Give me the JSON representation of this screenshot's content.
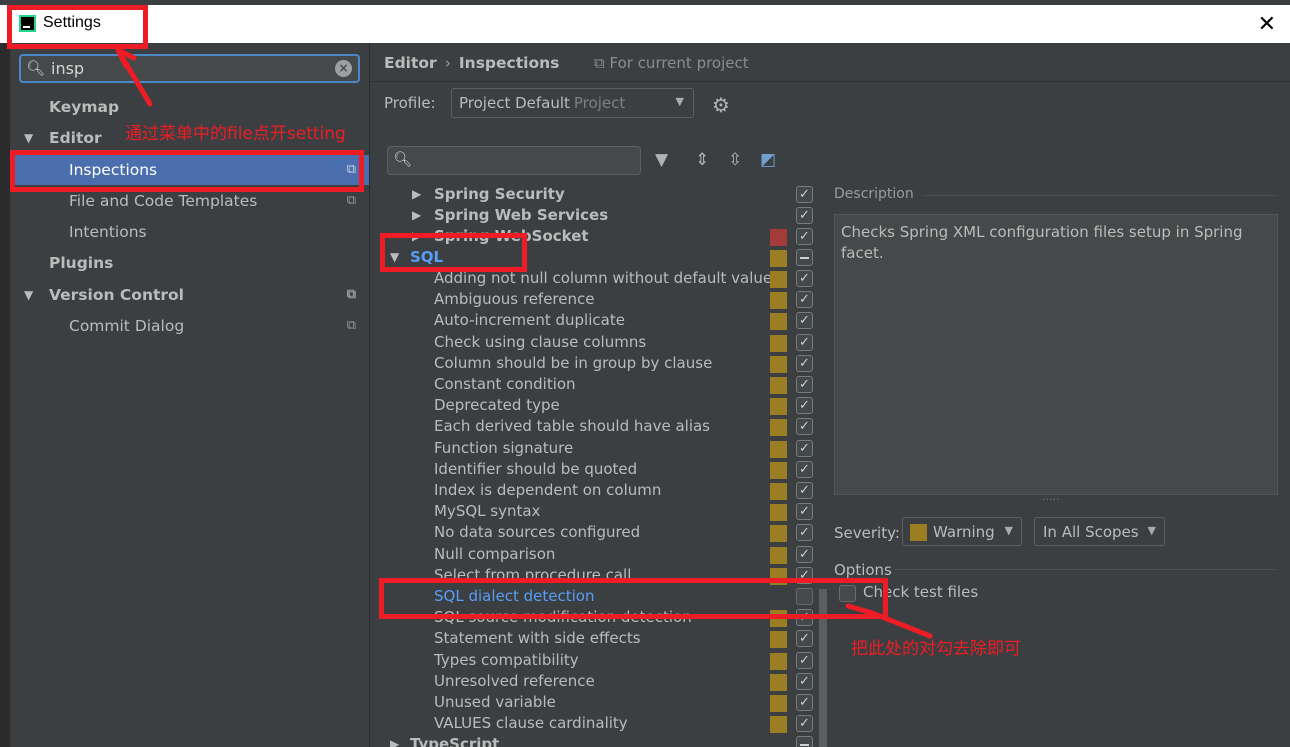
{
  "window": {
    "title": "Settings"
  },
  "sidebar": {
    "search_value": "insp",
    "items": [
      {
        "label": "Keymap"
      },
      {
        "label": "Editor"
      },
      {
        "label": "Inspections"
      },
      {
        "label": "File and Code Templates"
      },
      {
        "label": "Intentions"
      },
      {
        "label": "Plugins"
      },
      {
        "label": "Version Control"
      },
      {
        "label": "Commit Dialog"
      }
    ]
  },
  "header": {
    "breadcrumb": [
      "Editor",
      "Inspections"
    ],
    "for_current_project": "For current project",
    "profile_label": "Profile:",
    "profile_value": "Project Default",
    "profile_type": "Project"
  },
  "inspections": {
    "groups_before": [
      "Spring Security",
      "Spring Web Services",
      "Spring WebSocket"
    ],
    "sql_group": "SQL",
    "sql_items": [
      "Adding not null column without default value",
      "Ambiguous reference",
      "Auto-increment duplicate",
      "Check using clause columns",
      "Column should be in group by clause",
      "Constant condition",
      "Deprecated type",
      "Each derived table should have alias",
      "Function signature",
      "Identifier should be quoted",
      "Index is dependent on column",
      "MySQL syntax",
      "No data sources configured",
      "Null comparison",
      "Select from procedure call",
      "SQL dialect detection",
      "SQL source modification detection",
      "Statement with side effects",
      "Types compatibility",
      "Unresolved reference",
      "Unused variable",
      "VALUES clause cardinality"
    ],
    "group_after": "TypeScript"
  },
  "details": {
    "description_label": "Description",
    "description_text": "Checks Spring XML configuration files setup in Spring facet.",
    "severity_label": "Severity:",
    "severity_value": "Warning",
    "scope_value": "In All Scopes",
    "options_label": "Options",
    "check_test_files": "Check test files"
  },
  "annotations": {
    "note1": "通过菜单中的file点开setting",
    "note2": "把此处的对勾去除即可"
  },
  "colors": {
    "accent_selection": "#4b6eaf",
    "warning": "#9b7d24",
    "error": "#a33b3b",
    "annotation": "#ee1c25"
  },
  "icons": [
    "app-icon",
    "close-icon",
    "search-icon",
    "clear-icon",
    "settings-icon",
    "filter-icon",
    "expand-all-icon",
    "collapse-all-icon",
    "eraser-icon",
    "copy-icon"
  ]
}
